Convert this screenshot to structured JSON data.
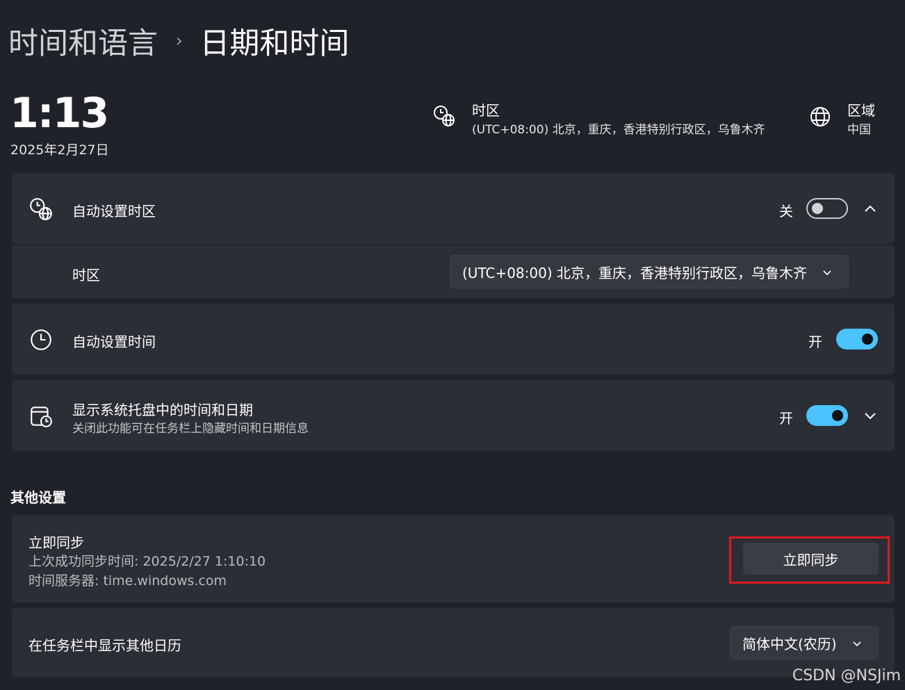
{
  "breadcrumb": {
    "parent": "时间和语言",
    "separator": "›",
    "current": "日期和时间"
  },
  "clock": {
    "time": "1:13",
    "date": "2025年2月27日"
  },
  "header": {
    "timezone": {
      "title": "时区",
      "value": "(UTC+08:00) 北京，重庆，香港特别行政区，乌鲁木齐",
      "icon": "timezone-globe-clock-icon"
    },
    "region": {
      "title": "区域",
      "value": "中国",
      "icon": "globe-icon"
    }
  },
  "settings": {
    "auto_timezone": {
      "label": "自动设置时区",
      "state": "关",
      "on": false,
      "icon": "timezone-globe-clock-icon"
    },
    "timezone_row": {
      "label": "时区",
      "value": "(UTC+08:00) 北京，重庆，香港特别行政区，乌鲁木齐"
    },
    "auto_time": {
      "label": "自动设置时间",
      "state": "开",
      "on": true,
      "icon": "clock-icon"
    },
    "tray_time": {
      "label": "显示系统托盘中的时间和日期",
      "description": "关闭此功能可在任务栏上隐藏时间和日期信息",
      "state": "开",
      "on": true,
      "icon": "calendar-clock-icon"
    }
  },
  "other": {
    "section_title": "其他设置",
    "sync": {
      "title": "立即同步",
      "last_sync": "上次成功同步时间: 2025/2/27 1:10:10",
      "server": "时间服务器: time.windows.com",
      "button_label": "立即同步"
    },
    "calendar": {
      "label": "在任务栏中显示其他日历",
      "value": "简体中文(农历)"
    }
  },
  "watermark": "CSDN @NSJim",
  "colors": {
    "background": "#1f2229",
    "card": "#2b2e35",
    "accent": "#4cc2ff",
    "highlight": "#e0191f"
  }
}
